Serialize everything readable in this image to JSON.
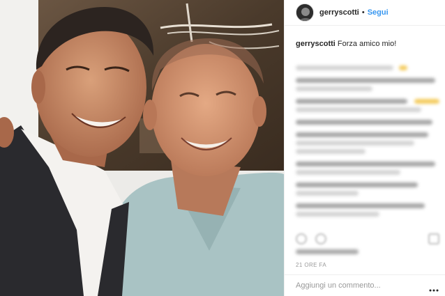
{
  "post": {
    "image": {
      "alt": "",
      "colors": {
        "wall": "#ecebe8",
        "painting": "#5a4a38",
        "skin": "#c98e6a",
        "jacket": "#2a2a2e",
        "white_shirt": "#f4f2ef",
        "blue_shirt": "#a9c3c4"
      }
    },
    "header": {
      "avatar_icon": "profile-avatar-icon",
      "username": "gerryscotti",
      "separator": "•",
      "follow_label": "Segui",
      "follow_color": "#3897f0"
    },
    "caption": {
      "username": "gerryscotti",
      "text": "Forza amico mio!"
    },
    "time_ago": "21 ORE FA",
    "comment_input": {
      "placeholder": "Aggiungi un commento..."
    },
    "more_icon": "more-options-icon"
  }
}
